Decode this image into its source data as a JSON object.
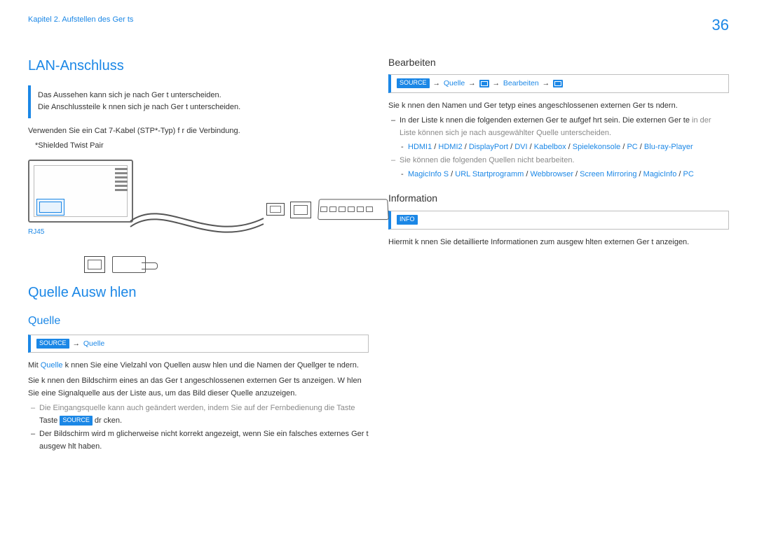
{
  "page_number": "36",
  "chapter": "Kapitel 2. Aufstellen des Ger ts",
  "left": {
    "h1": "LAN-Anschluss",
    "box_line1": "Das Aussehen kann sich je nach Ger t unterscheiden.",
    "box_line2": "Die Anschlussteile k nnen sich je nach Ger t unterscheiden.",
    "p1": "Verwenden Sie ein Cat 7-Kabel (STP*-Typ) f r die Verbindung.",
    "p1_note": "*Shielded Twist Pair",
    "rj45": "RJ45",
    "h1b": "Quelle Ausw hlen",
    "h2b": "Quelle",
    "nav_source": "SOURCE",
    "nav_quelle": "Quelle",
    "q_p1_a": "Mit ",
    "q_p1_b": "Quelle",
    "q_p1_c": " k nnen Sie eine Vielzahl von Quellen ausw hlen und die Namen der Quellger te  ndern.",
    "q_p2": "Sie k nnen den Bildschirm eines an das Ger t angeschlossenen externen Ger ts anzeigen. W hlen Sie eine Signalquelle aus der Liste aus, um das Bild dieser Quelle anzuzeigen.",
    "q_note1": "Die Eingangsquelle kann auch geändert werden, indem Sie auf der Fernbedienung die Taste",
    "q_note1b": " dr cken.",
    "q_note2": "Der Bildschirm wird m glicherweise nicht korrekt angezeigt, wenn Sie ein falsches externes Ger t ausgew hlt haben."
  },
  "right": {
    "h3a": "Bearbeiten",
    "nav_b_1": "SOURCE",
    "nav_b_2": "Quelle",
    "nav_b_3": "Bearbeiten",
    "r_p1": "Sie k nnen den Namen und Ger tetyp eines angeschlossenen externen Ger ts  ndern.",
    "r_b1": "In der Liste k nnen die folgenden externen Ger te aufgef hrt sein. Die externen Ger te in der Liste können sich je nach ausgewählter Quelle unterscheiden.",
    "r_b1_list": [
      "HDMI1",
      "HDMI2",
      "DisplayPort",
      "DVI",
      "Kabelbox",
      "Spielekonsole",
      "PC",
      "Blu-ray-Player"
    ],
    "r_b2": "Sie können die folgenden Quellen nicht bearbeiten.",
    "r_b2_list": [
      "MagicInfo S",
      "URL Startprogramm",
      "Webbrowser",
      "Screen Mirroring",
      "MagicInfo",
      "PC"
    ],
    "h3b": "Information",
    "nav_info": "INFO",
    "r_p2": "Hiermit k nnen Sie detaillierte Informationen zum ausgew hlten externen Ger t anzeigen."
  }
}
